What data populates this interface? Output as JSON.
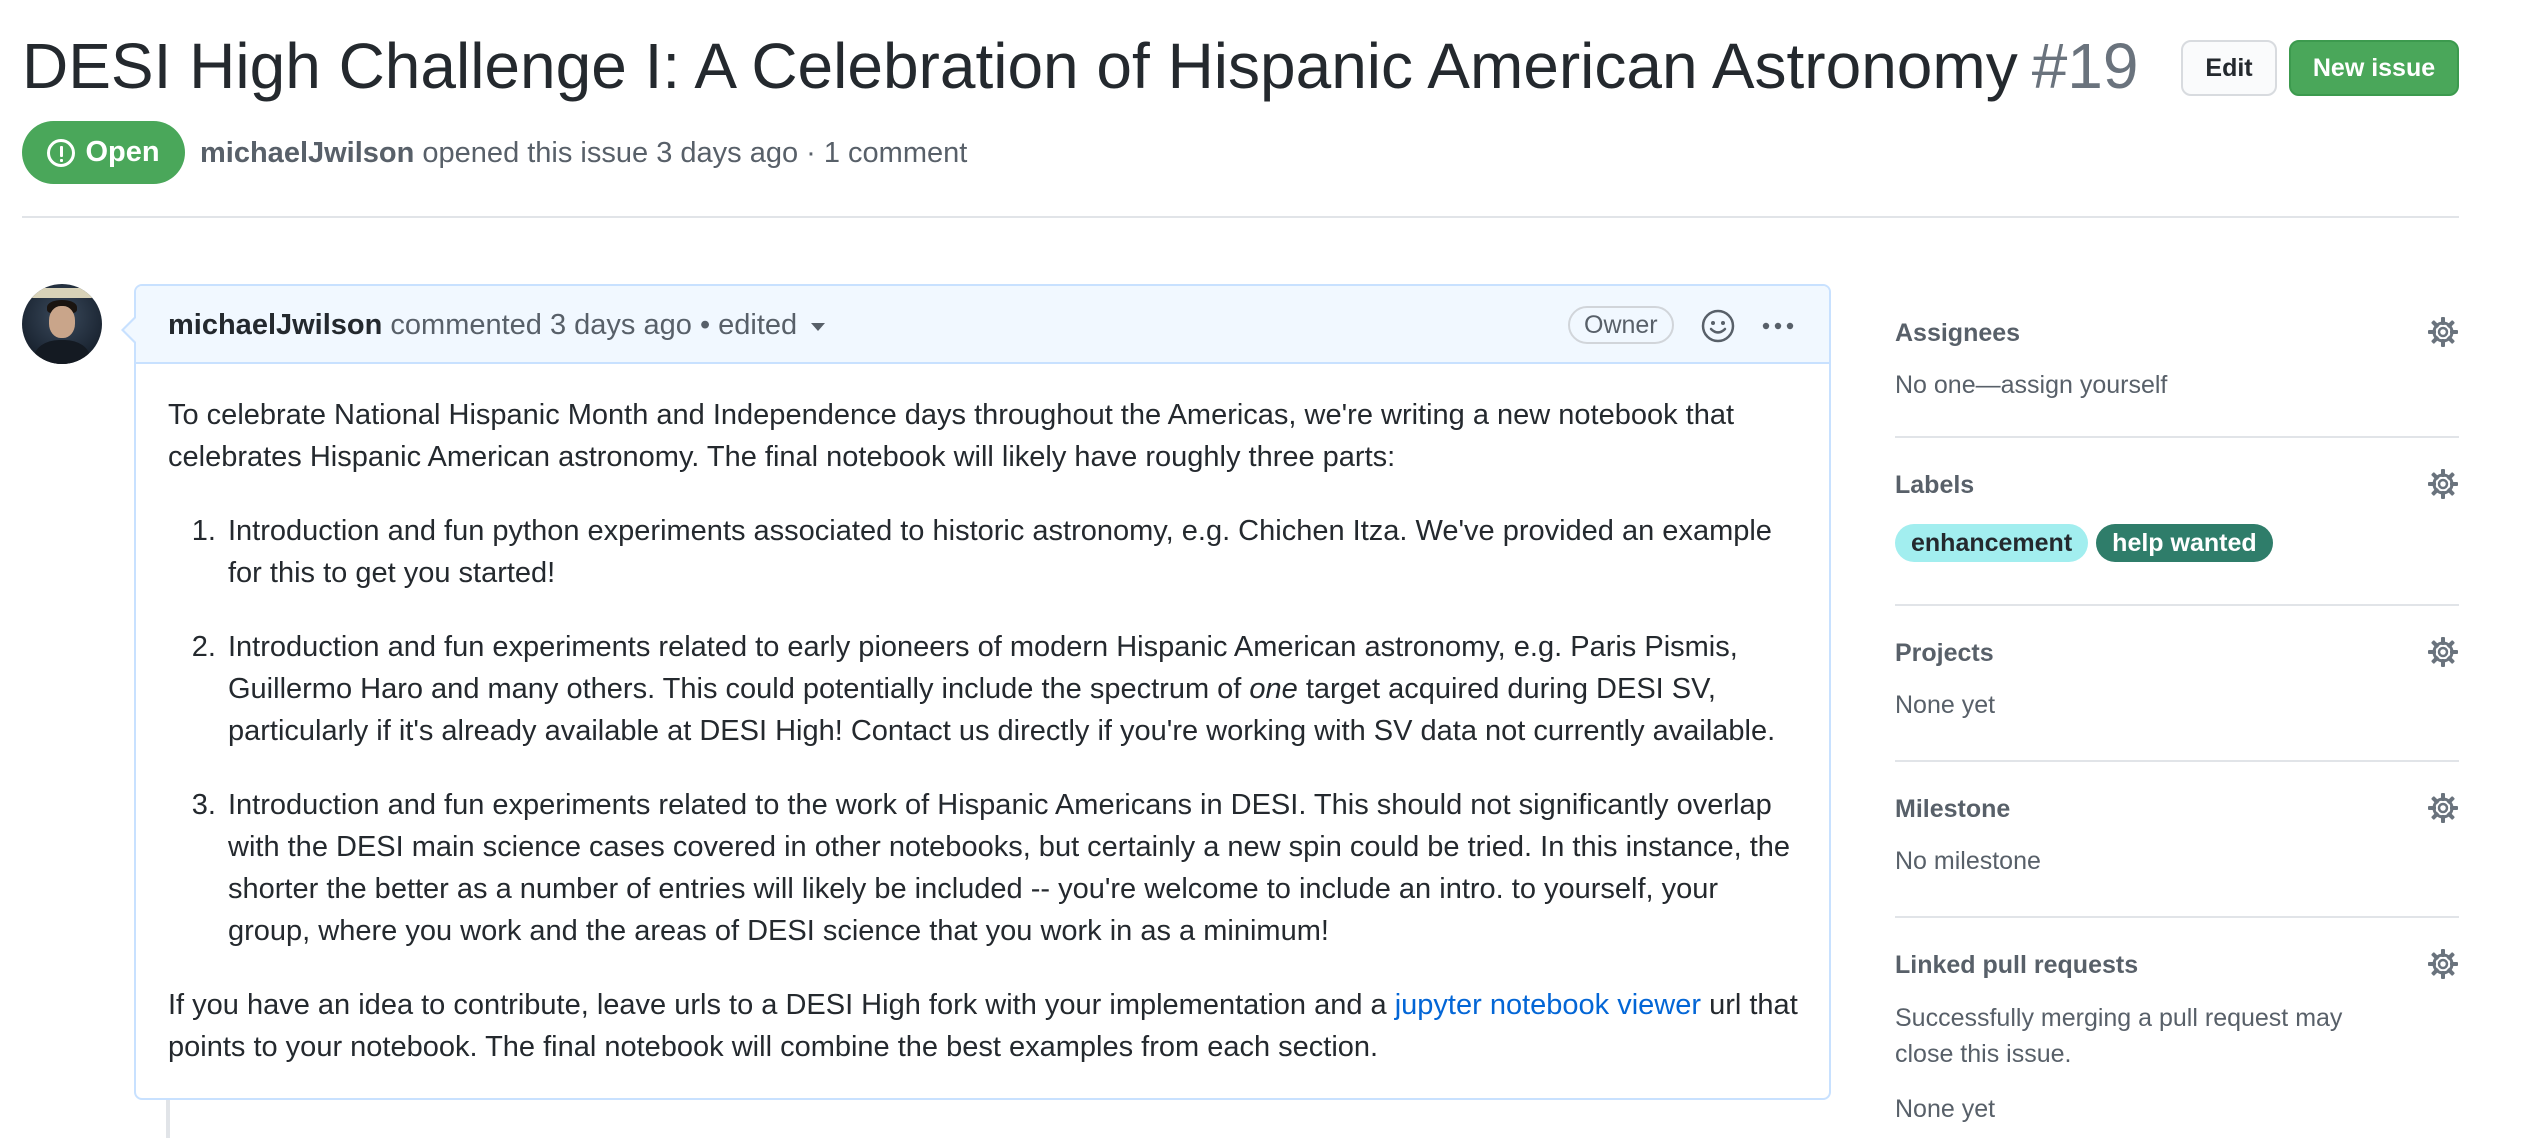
{
  "issue": {
    "title": "DESI High Challenge I: A Celebration of Hispanic American Astronomy",
    "number": "#19",
    "state": "Open",
    "author": "michaelJwilson",
    "opened_text": "opened this issue 3 days ago · 1 comment"
  },
  "buttons": {
    "edit": "Edit",
    "new_issue": "New issue"
  },
  "comment": {
    "author": "michaelJwilson",
    "meta": "commented 3 days ago",
    "edited": "• edited",
    "role_badge": "Owner",
    "body": {
      "intro": "To celebrate National Hispanic Month and Independence days throughout the Americas, we're writing a new notebook that celebrates Hispanic American astronomy. The final notebook will likely have roughly three parts:",
      "item1": "Introduction and fun python experiments associated to historic astronomy, e.g. Chichen Itza. We've provided an example for this to get you started!",
      "item2_before": "Introduction and fun experiments related to early pioneers of modern Hispanic American astronomy, e.g. Paris Pismis, Guillermo Haro and many others. This could potentially include the spectrum of ",
      "item2_em": "one",
      "item2_after": " target acquired during DESI SV, particularly if it's already available at DESI High! Contact us directly if you're working with SV data not currently available.",
      "item3": "Introduction and fun experiments related to the work of Hispanic Americans in DESI. This should not significantly overlap with the DESI main science cases covered in other notebooks, but certainly a new spin could be tried. In this instance, the shorter the better as a number of entries will likely be included -- you're welcome to include an intro. to yourself, your group, where you work and the areas of DESI science that you work in as a minimum!",
      "outro_before": "If you have an idea to contribute, leave urls to a DESI High fork with your implementation and a ",
      "outro_link": "jupyter notebook viewer",
      "outro_after": " url that points to your notebook. The final notebook will combine the best examples from each section."
    }
  },
  "sidebar": {
    "assignees": {
      "heading": "Assignees",
      "value": "No one—assign yourself"
    },
    "labels": {
      "heading": "Labels",
      "items": [
        {
          "name": "enhancement",
          "color": "#a2eeef"
        },
        {
          "name": "help wanted",
          "color": "#2f7d6a"
        }
      ]
    },
    "projects": {
      "heading": "Projects",
      "value": "None yet"
    },
    "milestone": {
      "heading": "Milestone",
      "value": "No milestone"
    },
    "linked_prs": {
      "heading": "Linked pull requests",
      "description": "Successfully merging a pull request may close this issue.",
      "value": "None yet"
    }
  },
  "colors": {
    "open_green": "#4aa75a",
    "comment_border": "#c8e1ff",
    "comment_header_bg": "#f1f8ff",
    "link": "#0366d6"
  }
}
